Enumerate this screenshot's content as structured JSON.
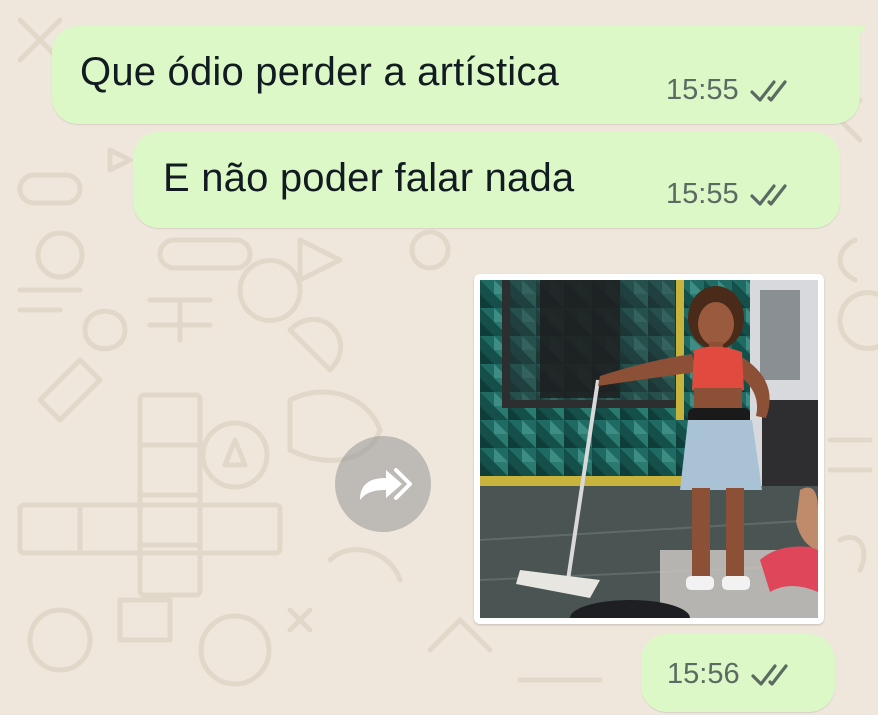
{
  "messages": [
    {
      "text": "Que ódio perder a artística",
      "time": "15:55",
      "status": "read"
    },
    {
      "text": "E não poder falar nada",
      "time": "15:55",
      "status": "read"
    },
    {
      "type": "image",
      "time": "15:56",
      "status": "read"
    }
  ],
  "colors": {
    "bubble_outgoing": "#dcf8c6",
    "wallpaper": "#efe7dc",
    "read_ticks": "#5b6a63"
  },
  "icons": {
    "forward": "forward-icon",
    "read_status": "double-check-icon"
  }
}
